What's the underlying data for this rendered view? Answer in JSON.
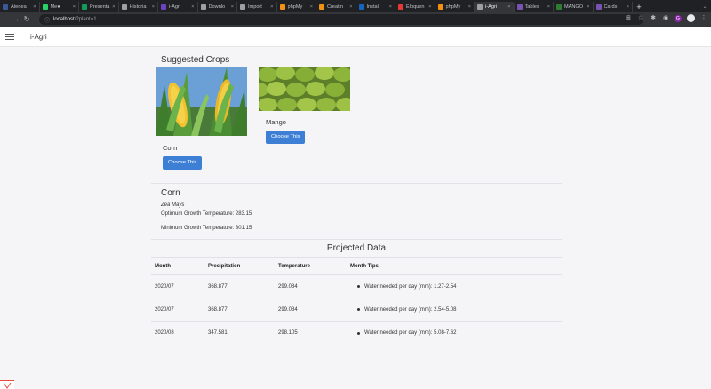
{
  "browser": {
    "tabs": [
      {
        "title": "Atenea",
        "color": "#3b5998"
      },
      {
        "title": "Me●",
        "color": "#25d366"
      },
      {
        "title": "Presenta",
        "color": "#0f9d58"
      },
      {
        "title": "Historia",
        "color": "#9aa0a6"
      },
      {
        "title": "i-Agri",
        "color": "#6f42c1"
      },
      {
        "title": "Downlo",
        "color": "#9aa0a6"
      },
      {
        "title": "Import",
        "color": "#9aa0a6"
      },
      {
        "title": "phpMy",
        "color": "#f29111"
      },
      {
        "title": "Creatin",
        "color": "#f29111"
      },
      {
        "title": "Install",
        "color": "#1565c0"
      },
      {
        "title": "Eloquen",
        "color": "#e53935"
      },
      {
        "title": "phpMy",
        "color": "#f29111"
      },
      {
        "title": "i-Agri",
        "color": "#9aa0a6",
        "active": true
      },
      {
        "title": "Tables",
        "color": "#7952b3"
      },
      {
        "title": "MANGO",
        "color": "#2e7d32"
      },
      {
        "title": "Cards",
        "color": "#7952b3"
      }
    ],
    "url_host": "localhost",
    "url_path": "/?plant=1"
  },
  "navbar": {
    "brand": "i-Agri"
  },
  "suggested": {
    "title": "Suggested Crops",
    "crops": [
      {
        "name": "Corn",
        "button": "Choose This"
      },
      {
        "name": "Mango",
        "button": "Choose This"
      }
    ]
  },
  "detail": {
    "name": "Corn",
    "scientific_name": "Zea Mays",
    "optimum_temp": "Optimum Growth Temperature: 283.15",
    "minimum_temp": "Minimum Growth Temperature: 301.15"
  },
  "projected": {
    "title": "Projected Data",
    "headers": [
      "Month",
      "Precipitation",
      "Temperature",
      "Month Tips"
    ],
    "rows": [
      {
        "month": "2020/07",
        "precipitation": "368.877",
        "temperature": "299.084",
        "tip": "Water needed per day (mm): 1.27-2.54"
      },
      {
        "month": "2020/07",
        "precipitation": "368.877",
        "temperature": "299.084",
        "tip": "Water needed per day (mm): 2.54-5.08"
      },
      {
        "month": "2020/08",
        "precipitation": "347.581",
        "temperature": "298.105",
        "tip": "Water needed per day (mm): 5.08-7.62"
      }
    ]
  },
  "colors": {
    "primary_button": "#3d7fd5",
    "chrome_dark": "#202124"
  }
}
